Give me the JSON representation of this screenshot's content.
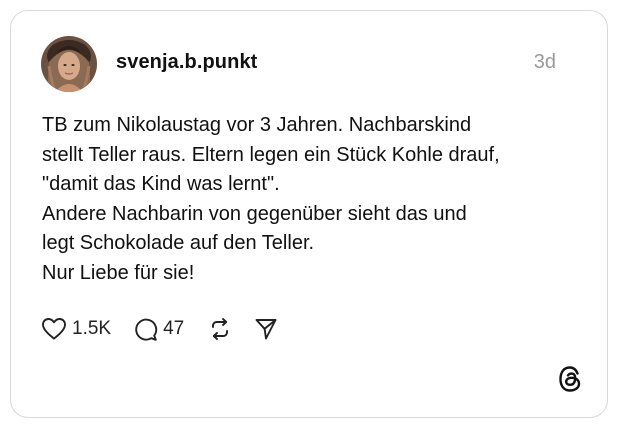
{
  "post": {
    "username": "svenja.b.punkt",
    "time": "3d",
    "lines": [
      "TB zum Nikolaustag vor 3 Jahren. Nachbarskind",
      "stellt Teller raus. Eltern legen ein Stück Kohle drauf,",
      "\"damit das Kind was lernt\".",
      "Andere Nachbarin von gegenüber sieht das und",
      "legt Schokolade auf den Teller.",
      "Nur Liebe für sie!"
    ],
    "likes": "1.5K",
    "replies": "47"
  },
  "icons": {
    "like": "heart-icon",
    "reply": "comment-bubble-icon",
    "repost": "repost-icon",
    "share": "send-icon",
    "brand": "threads-logo-icon"
  },
  "colors": {
    "text": "#111111",
    "muted": "#9a9a9a",
    "border": "#d9d9d9"
  }
}
